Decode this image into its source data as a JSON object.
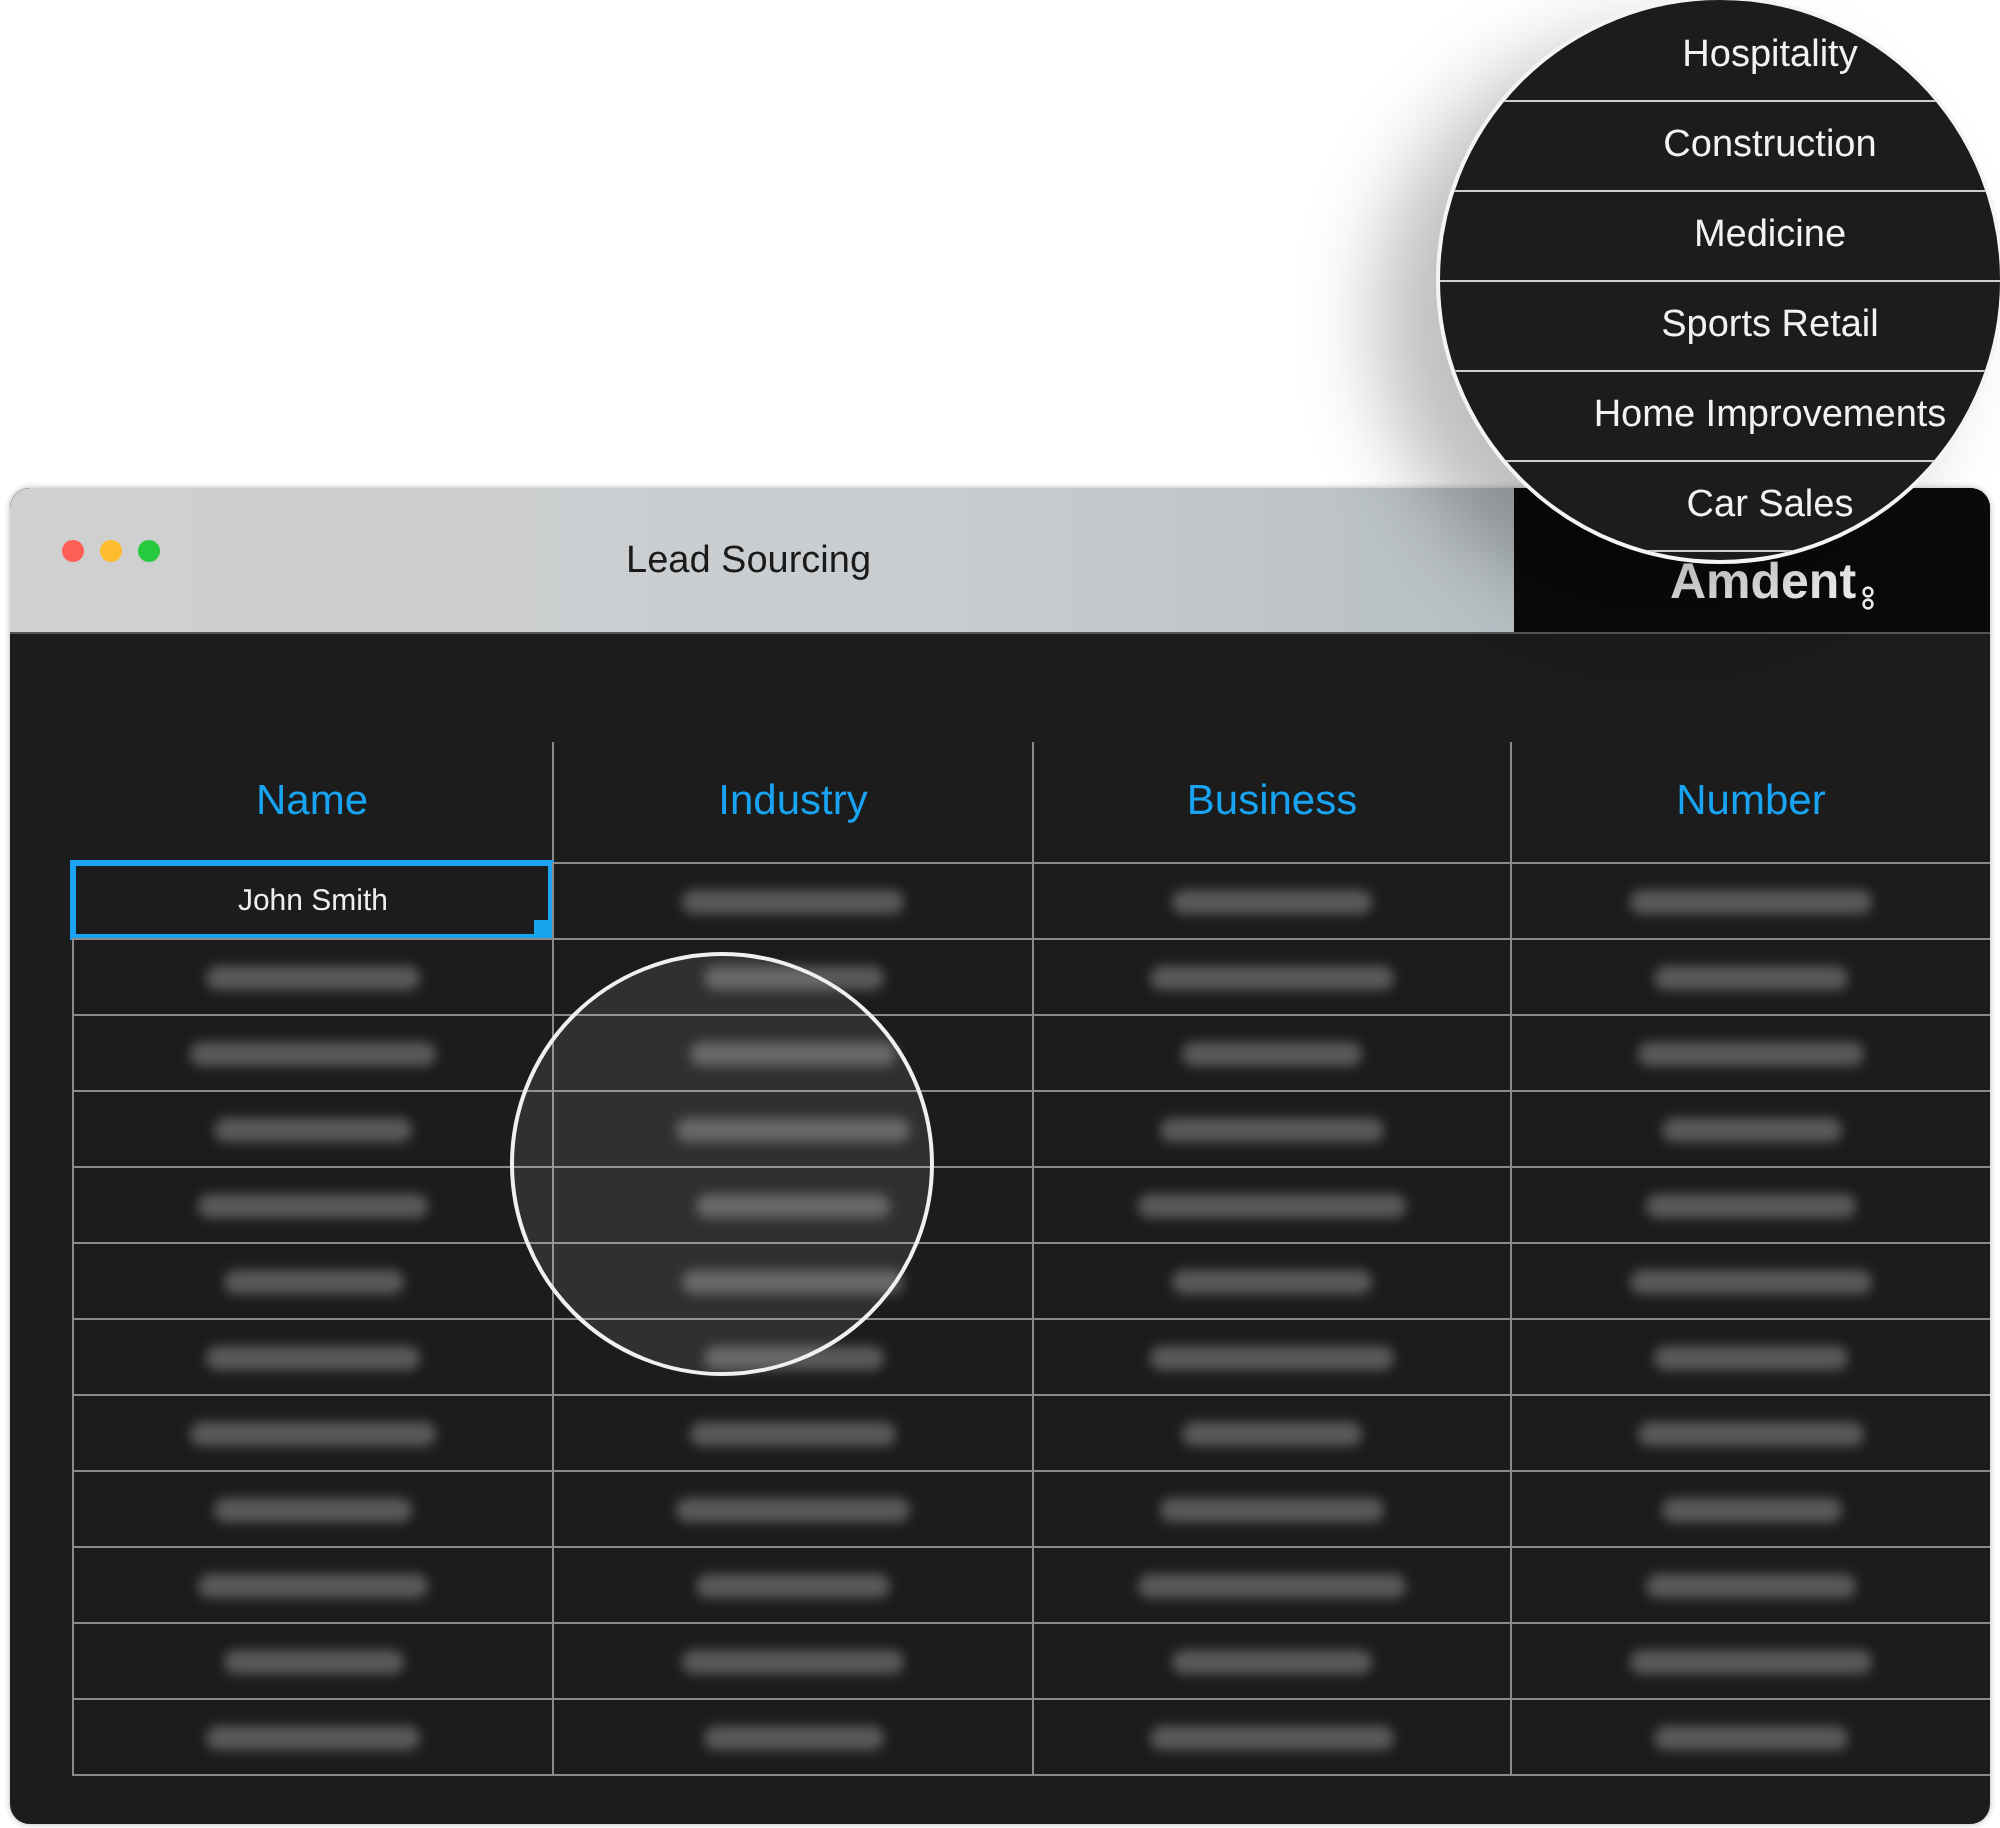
{
  "window": {
    "title": "Lead Sourcing",
    "controls": [
      {
        "kind": "close"
      },
      {
        "kind": "minimize"
      },
      {
        "kind": "zoom"
      }
    ],
    "logo": "Amdent"
  },
  "table": {
    "columns": [
      "Name",
      "Industry",
      "Business",
      "Number"
    ],
    "rows": [
      {
        "cells": [
          {
            "text": "John Smith",
            "selected": true
          },
          {
            "blurred": true,
            "selected": false
          },
          {
            "blurred": true,
            "selected": false
          },
          {
            "blurred": true,
            "selected": false
          }
        ]
      },
      {
        "cells": [
          {
            "blurred": true,
            "selected": false
          },
          {
            "blurred": true,
            "selected": false
          },
          {
            "blurred": true,
            "selected": false
          },
          {
            "blurred": true,
            "selected": false
          }
        ]
      },
      {
        "cells": [
          {
            "blurred": true,
            "selected": false
          },
          {
            "blurred": true,
            "selected": false
          },
          {
            "blurred": true,
            "selected": false
          },
          {
            "blurred": true,
            "selected": false
          }
        ]
      },
      {
        "cells": [
          {
            "blurred": true,
            "selected": false
          },
          {
            "blurred": true,
            "selected": false
          },
          {
            "blurred": true,
            "selected": false
          },
          {
            "blurred": true,
            "selected": false
          }
        ]
      },
      {
        "cells": [
          {
            "blurred": true,
            "selected": false
          },
          {
            "blurred": true,
            "selected": false
          },
          {
            "blurred": true,
            "selected": false
          },
          {
            "blurred": true,
            "selected": false
          }
        ]
      },
      {
        "cells": [
          {
            "blurred": true,
            "selected": false
          },
          {
            "blurred": true,
            "selected": false
          },
          {
            "blurred": true,
            "selected": false
          },
          {
            "blurred": true,
            "selected": false
          }
        ]
      },
      {
        "cells": [
          {
            "blurred": true,
            "selected": false
          },
          {
            "blurred": true,
            "selected": false
          },
          {
            "blurred": true,
            "selected": false
          },
          {
            "blurred": true,
            "selected": false
          }
        ]
      },
      {
        "cells": [
          {
            "blurred": true,
            "selected": false
          },
          {
            "blurred": true,
            "selected": false
          },
          {
            "blurred": true,
            "selected": false
          },
          {
            "blurred": true,
            "selected": false
          }
        ]
      },
      {
        "cells": [
          {
            "blurred": true,
            "selected": false
          },
          {
            "blurred": true,
            "selected": false
          },
          {
            "blurred": true,
            "selected": false
          },
          {
            "blurred": true,
            "selected": false
          }
        ]
      },
      {
        "cells": [
          {
            "blurred": true,
            "selected": false
          },
          {
            "blurred": true,
            "selected": false
          },
          {
            "blurred": true,
            "selected": false
          },
          {
            "blurred": true,
            "selected": false
          }
        ]
      },
      {
        "cells": [
          {
            "blurred": true,
            "selected": false
          },
          {
            "blurred": true,
            "selected": false
          },
          {
            "blurred": true,
            "selected": false
          },
          {
            "blurred": true,
            "selected": false
          }
        ]
      },
      {
        "cells": [
          {
            "blurred": true,
            "selected": false
          },
          {
            "blurred": true,
            "selected": false
          },
          {
            "blurred": true,
            "selected": false
          },
          {
            "blurred": true,
            "selected": false
          }
        ]
      }
    ]
  },
  "magnifier": {
    "items": [
      "Hospitality",
      "Construction",
      "Medicine",
      "Sports Retail",
      "Home Improvements",
      "Car Sales"
    ]
  }
}
